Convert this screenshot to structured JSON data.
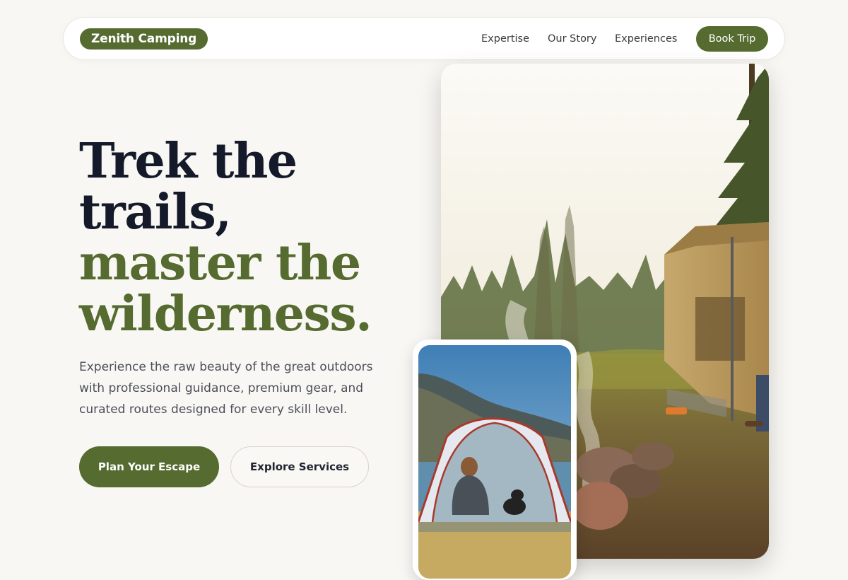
{
  "nav": {
    "brand": "Zenith Camping",
    "links": [
      "Expertise",
      "Our Story",
      "Experiences"
    ],
    "cta": "Book Trip"
  },
  "hero": {
    "headline_line1": "Trek the",
    "headline_line2": "trails,",
    "headline_line3": "master the",
    "headline_line4": "wilderness.",
    "subtext": "Experience the raw beauty of the great outdoors with professional guidance, premium gear, and curated routes designed for every skill level.",
    "primary_button": "Plan Your Escape",
    "secondary_button": "Explore Services"
  },
  "colors": {
    "accent": "#556b2f",
    "heading_dark": "#141a2a",
    "background": "#f9f7f3"
  }
}
